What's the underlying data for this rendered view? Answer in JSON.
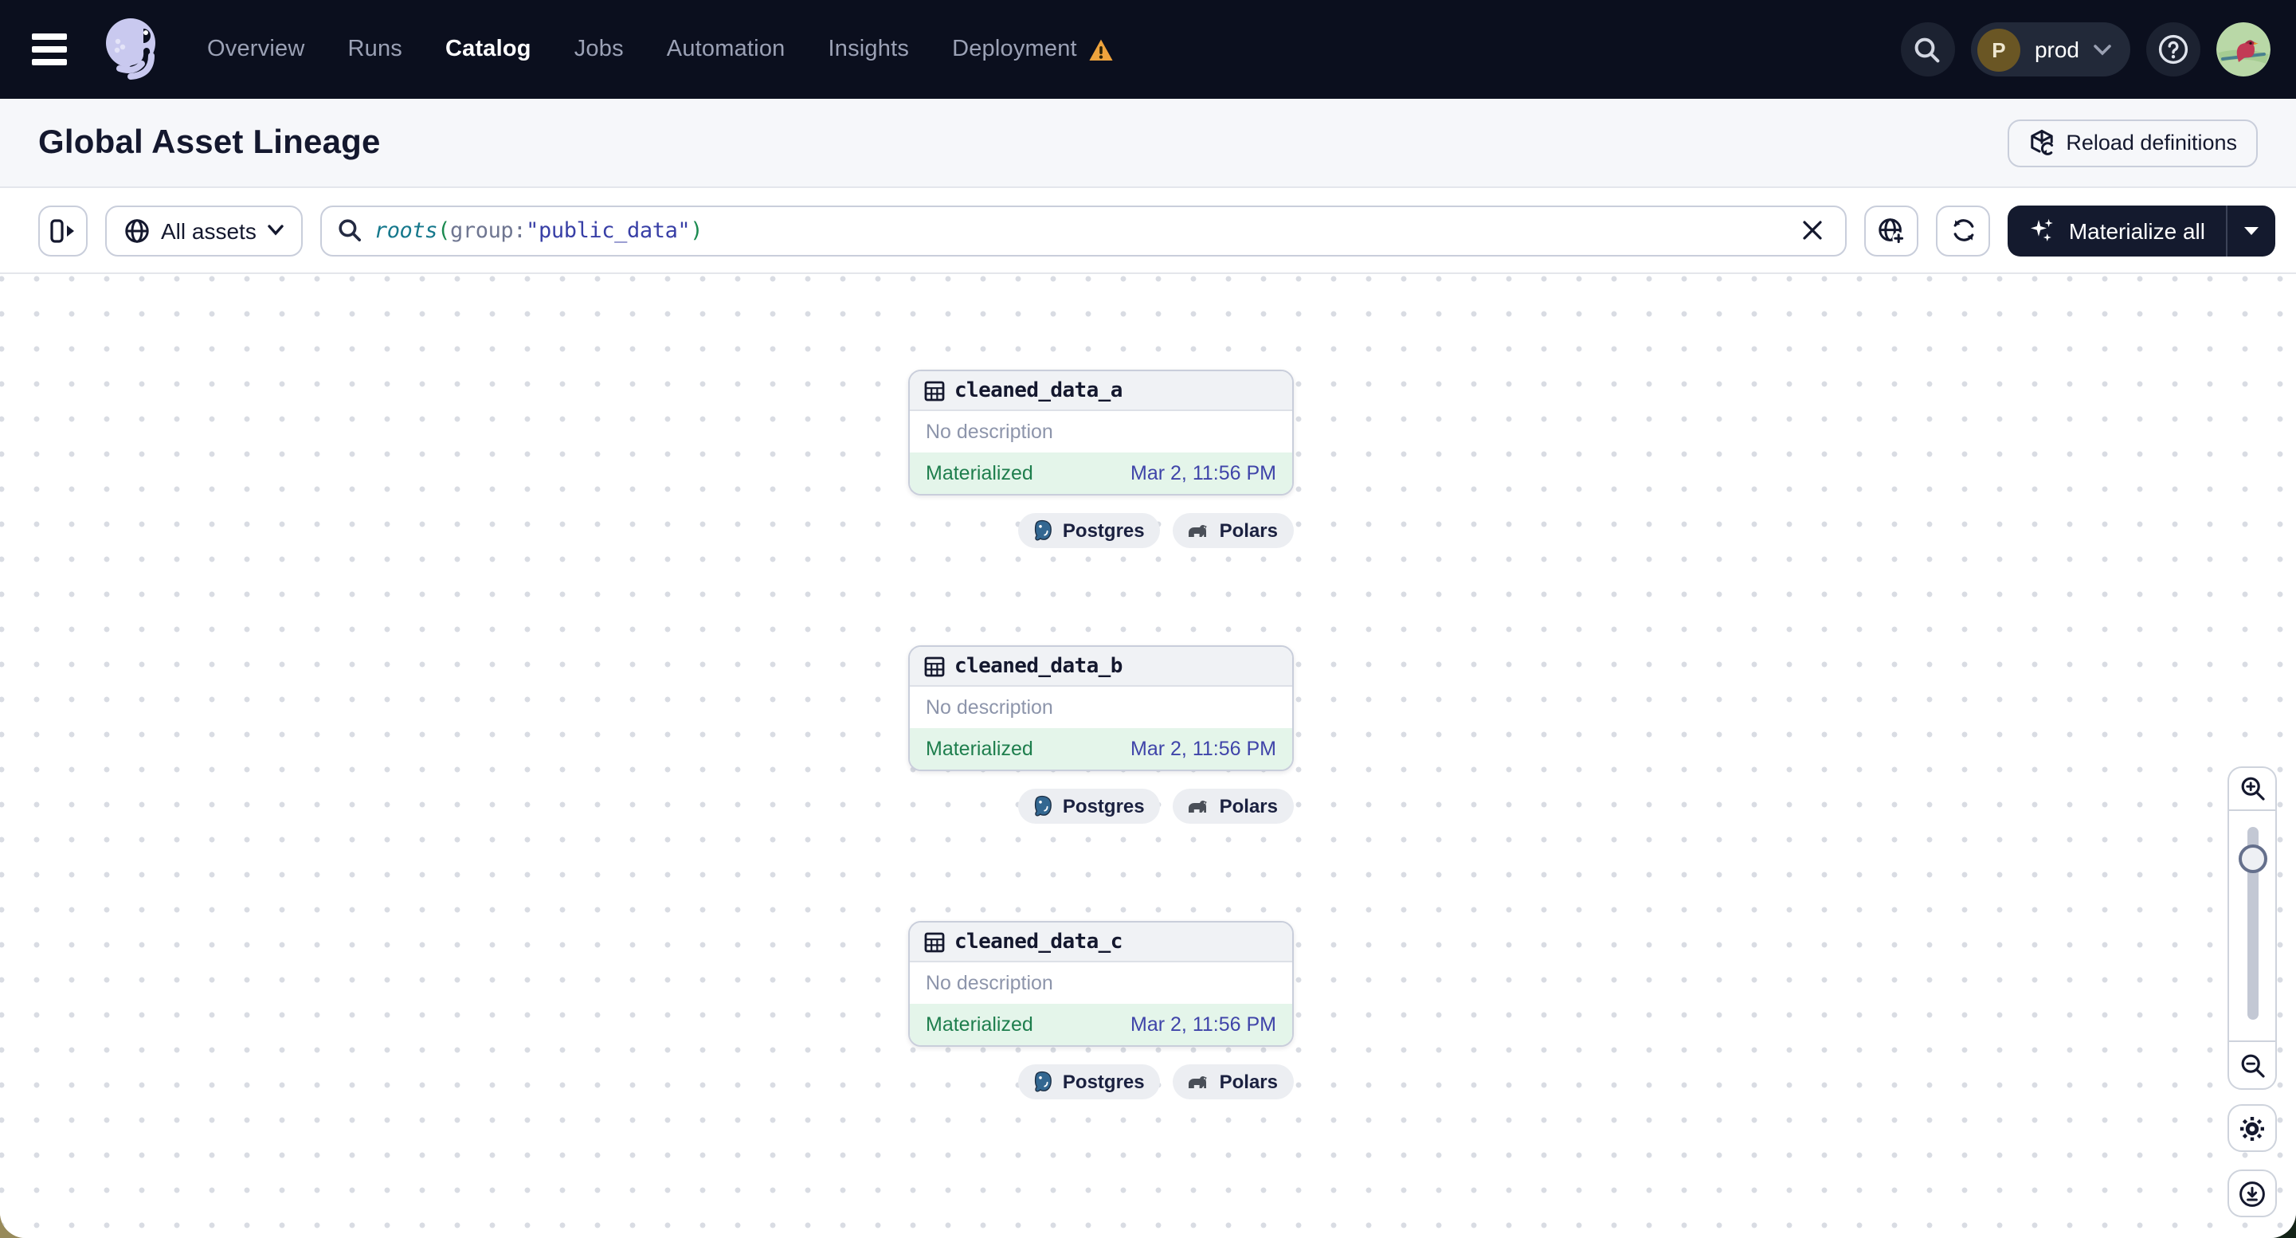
{
  "nav": {
    "items": [
      {
        "label": "Overview"
      },
      {
        "label": "Runs"
      },
      {
        "label": "Catalog"
      },
      {
        "label": "Jobs"
      },
      {
        "label": "Automation"
      },
      {
        "label": "Insights"
      },
      {
        "label": "Deployment"
      }
    ],
    "active_item": "Catalog",
    "deployment_has_warning": true,
    "environment": {
      "initial": "P",
      "name": "prod"
    }
  },
  "page_header": {
    "title": "Global Asset Lineage",
    "reload_button_label": "Reload definitions"
  },
  "toolbar": {
    "asset_filter_label": "All assets",
    "query_segments": [
      {
        "text": "roots",
        "token": "function"
      },
      {
        "text": "(",
        "token": "paren"
      },
      {
        "text": "group:",
        "token": "key"
      },
      {
        "text": "\"public_data\"",
        "token": "string"
      },
      {
        "text": ")",
        "token": "paren"
      }
    ],
    "materialize_button_label": "Materialize all"
  },
  "graph": {
    "assets": [
      {
        "name": "cleaned_data_a",
        "description": "No description",
        "status": "Materialized",
        "materialized_at": "Mar 2, 11:56 PM",
        "tags": [
          {
            "label": "Postgres"
          },
          {
            "label": "Polars"
          }
        ]
      },
      {
        "name": "cleaned_data_b",
        "description": "No description",
        "status": "Materialized",
        "materialized_at": "Mar 2, 11:56 PM",
        "tags": [
          {
            "label": "Postgres"
          },
          {
            "label": "Polars"
          }
        ]
      },
      {
        "name": "cleaned_data_c",
        "description": "No description",
        "status": "Materialized",
        "materialized_at": "Mar 2, 11:56 PM",
        "tags": [
          {
            "label": "Postgres"
          },
          {
            "label": "Polars"
          }
        ]
      }
    ]
  },
  "colors": {
    "nav_bg": "#0b0f1e",
    "logo_lavender": "#c9c9ef",
    "warning_orange": "#eea33d",
    "status_green": "#1e7e4d",
    "status_bg_green": "#e4f5ea",
    "timestamp_indigo": "#3f44a9",
    "materialize_bg": "#141a2e",
    "postgres_blue": "#336791"
  }
}
